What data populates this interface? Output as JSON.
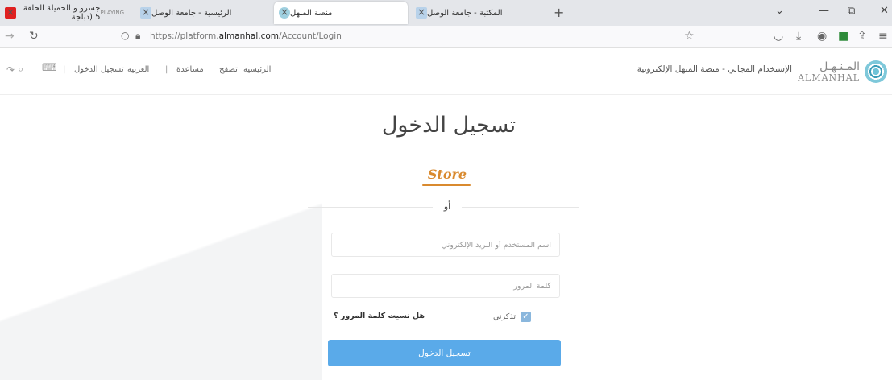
{
  "tabs": [
    {
      "label": "جسرو و الحميلة الحلقة 5 (دبلجة",
      "sub": "PLAYING",
      "active": false
    },
    {
      "label": "الرئيسية - جامعة الوصل",
      "active": false
    },
    {
      "label": "منصة المنهل",
      "active": true
    },
    {
      "label": "المكتبة - جامعة الوصل",
      "active": false
    }
  ],
  "browser": {
    "url_prefix": "https://platform.",
    "url_domain": "almanhal.com",
    "url_path": "/Account/Login",
    "new_tab": "+",
    "close": "×",
    "minimize": "—",
    "restore": "⧉",
    "window_close": "✕",
    "chevron": "⌄"
  },
  "nav": {
    "home": "الرئيسية",
    "browse": "تصفح",
    "help": "مساعدة",
    "language": "العربية",
    "login": "تسجيل الدخول",
    "separator": "|"
  },
  "brand": {
    "logo_ar": "المـنـهـل",
    "logo_en": "ALMANHAL",
    "tagline": "الإستخدام المجاني - منصة المنهل الإلكترونية"
  },
  "login": {
    "title": "تسجيل الدخول",
    "store_label": "Store",
    "or": "أو",
    "username_placeholder": "اسم المستخدم أو البريد الإلكتروني",
    "password_placeholder": "كلمة المرور",
    "remember_me": "تذكرني",
    "forgot_password": "هل نسيت كلمة المرور ؟",
    "submit": "تسجيل الدخول"
  },
  "colors": {
    "accent": "#5aaae9",
    "store": "#d98a2f"
  }
}
